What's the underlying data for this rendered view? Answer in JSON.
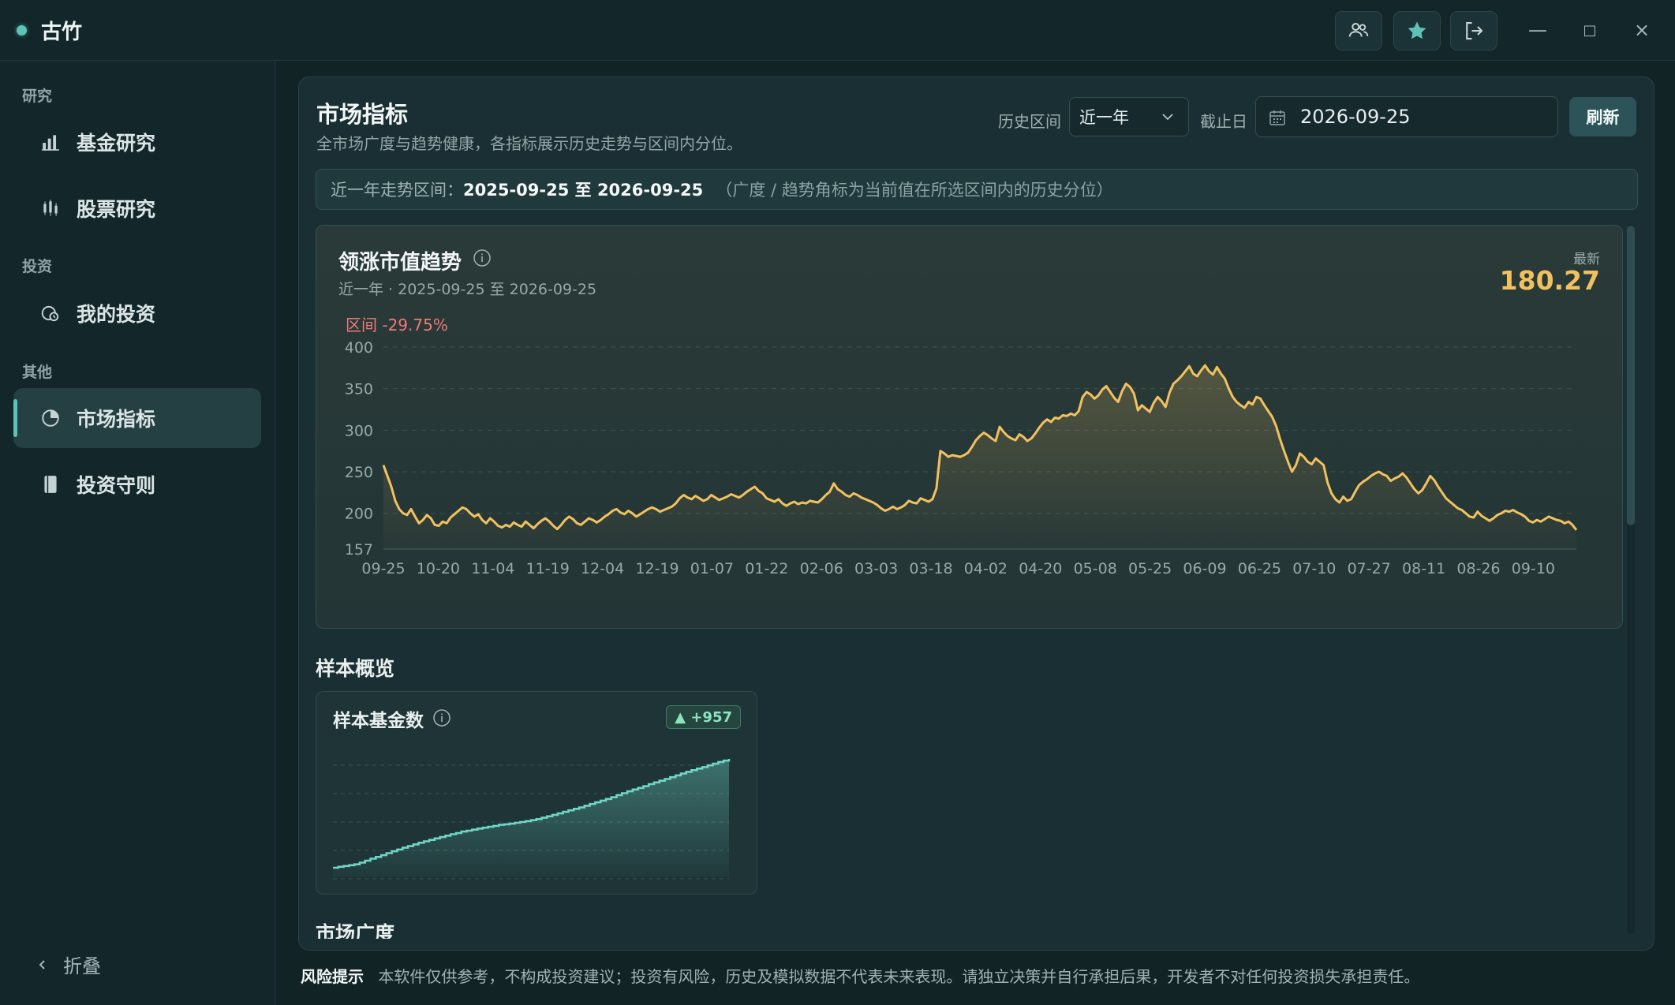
{
  "app": {
    "name": "古竹"
  },
  "window": {
    "minimize": "—",
    "maximize": "□",
    "close": "×"
  },
  "sidebar": {
    "groups": [
      {
        "label": "研究"
      },
      {
        "label": "投资"
      },
      {
        "label": "其他"
      }
    ],
    "items": [
      {
        "label": "基金研究",
        "icon": "bar-chart-icon"
      },
      {
        "label": "股票研究",
        "icon": "candlestick-icon"
      },
      {
        "label": "我的投资",
        "icon": "portfolio-icon"
      },
      {
        "label": "市场指标",
        "icon": "pie-chart-icon",
        "active": true
      },
      {
        "label": "投资守则",
        "icon": "book-icon"
      }
    ],
    "collapse_label": "折叠"
  },
  "header": {
    "title": "市场指标",
    "subtitle": "全市场广度与趋势健康，各指标展示历史走势与区间内分位。",
    "history_label": "历史区间",
    "history_value": "近一年",
    "cutoff_label": "截止日",
    "cutoff_value": "2026-09-25",
    "refresh_label": "刷新"
  },
  "range_bar": {
    "label": "近一年走势区间：",
    "range": "2025-09-25 至 2026-09-25",
    "note": "（广度 / 趋势角标为当前值在所选区间内的历史分位）"
  },
  "trend_card": {
    "title": "领涨市值趋势",
    "subtitle": "近一年 · 2025-09-25 至 2026-09-25",
    "latest_label": "最新",
    "latest_value": "180.27",
    "change_label": "区间 -29.75%"
  },
  "sample_section": {
    "title": "样本概览",
    "card_title": "样本基金数",
    "badge": "▲ +957"
  },
  "next_section": {
    "title": "市场广度"
  },
  "risk": {
    "title": "风险提示",
    "text": "本软件仅供参考，不构成投资建议；投资有风险，历史及模拟数据不代表未来表现。请独立决策并自行承担后果，开发者不对任何投资损失承担责任。"
  },
  "colors": {
    "accent": "#5fc2b7",
    "trend_line": "#f2c15f",
    "negative": "#f07a78",
    "sample_line": "#6fd6c6"
  },
  "chart_data": [
    {
      "type": "area",
      "yticks": [
        "400",
        "350",
        "300",
        "250",
        "200",
        "157"
      ],
      "ylim": [
        157,
        400
      ],
      "xticks": [
        "09-25",
        "10-20",
        "11-04",
        "11-19",
        "12-04",
        "12-19",
        "01-07",
        "01-22",
        "02-06",
        "03-03",
        "03-18",
        "04-02",
        "04-20",
        "05-08",
        "05-25",
        "06-09",
        "06-25",
        "07-10",
        "07-27",
        "08-11",
        "08-26",
        "09-10"
      ],
      "grid": true,
      "series": [
        {
          "values": [
            258,
            245,
            232,
            215,
            205,
            200,
            198,
            205,
            196,
            188,
            192,
            198,
            194,
            186,
            185,
            190,
            188,
            195,
            199,
            203,
            207,
            205,
            200,
            196,
            199,
            192,
            188,
            194,
            190,
            185,
            183,
            186,
            184,
            189,
            186,
            184,
            190,
            186,
            182,
            187,
            191,
            194,
            190,
            185,
            181,
            186,
            192,
            196,
            193,
            188,
            186,
            190,
            194,
            192,
            189,
            192,
            196,
            199,
            203,
            205,
            201,
            199,
            203,
            200,
            196,
            199,
            202,
            205,
            207,
            205,
            202,
            204,
            206,
            208,
            212,
            218,
            222,
            219,
            217,
            221,
            218,
            215,
            217,
            222,
            219,
            216,
            218,
            220,
            223,
            221,
            219,
            222,
            226,
            229,
            232,
            227,
            224,
            218,
            216,
            214,
            217,
            212,
            209,
            212,
            214,
            211,
            213,
            212,
            215,
            214,
            213,
            217,
            222,
            226,
            236,
            229,
            226,
            222,
            220,
            224,
            222,
            219,
            217,
            215,
            213,
            210,
            206,
            203,
            205,
            208,
            205,
            207,
            210,
            215,
            213,
            212,
            218,
            216,
            214,
            217,
            230,
            275,
            272,
            268,
            270,
            269,
            268,
            270,
            273,
            280,
            288,
            293,
            297,
            294,
            290,
            287,
            304,
            298,
            293,
            290,
            288,
            295,
            292,
            287,
            290,
            296,
            303,
            309,
            313,
            310,
            315,
            314,
            318,
            317,
            320,
            318,
            323,
            340,
            346,
            343,
            338,
            342,
            349,
            353,
            346,
            339,
            334,
            347,
            356,
            352,
            344,
            324,
            330,
            326,
            322,
            333,
            340,
            335,
            328,
            345,
            356,
            360,
            365,
            371,
            377,
            368,
            365,
            372,
            378,
            371,
            367,
            376,
            368,
            362,
            350,
            340,
            334,
            330,
            327,
            334,
            331,
            340,
            338,
            330,
            323,
            316,
            305,
            289,
            275,
            262,
            250,
            258,
            272,
            268,
            262,
            259,
            266,
            262,
            258,
            237,
            224,
            217,
            213,
            220,
            215,
            217,
            226,
            234,
            238,
            241,
            245,
            248,
            250,
            247,
            245,
            239,
            242,
            244,
            248,
            243,
            236,
            229,
            224,
            228,
            236,
            245,
            240,
            232,
            225,
            218,
            214,
            210,
            206,
            204,
            200,
            196,
            195,
            202,
            197,
            194,
            191,
            194,
            198,
            200,
            203,
            202,
            204,
            201,
            199,
            196,
            191,
            189,
            192,
            190,
            193,
            196,
            194,
            192,
            191,
            188,
            190,
            186,
            180
          ]
        }
      ]
    },
    {
      "type": "area",
      "series": [
        {
          "values": [
            0,
            8,
            15,
            22,
            30,
            45,
            62,
            80,
            95,
            110,
            128,
            145,
            160,
            176,
            190,
            205,
            220,
            232,
            245,
            258,
            270,
            282,
            295,
            305,
            318,
            326,
            335,
            345,
            352,
            360,
            368,
            377,
            382,
            388,
            395,
            402,
            410,
            418,
            428,
            440,
            452,
            465,
            478,
            492,
            505,
            518,
            530,
            545,
            560,
            575,
            590,
            605,
            620,
            638,
            655,
            672,
            688,
            702,
            718,
            735,
            750,
            765,
            780,
            796,
            812,
            828,
            843,
            858,
            872,
            885,
            900,
            915,
            930,
            942,
            957
          ]
        }
      ]
    }
  ]
}
